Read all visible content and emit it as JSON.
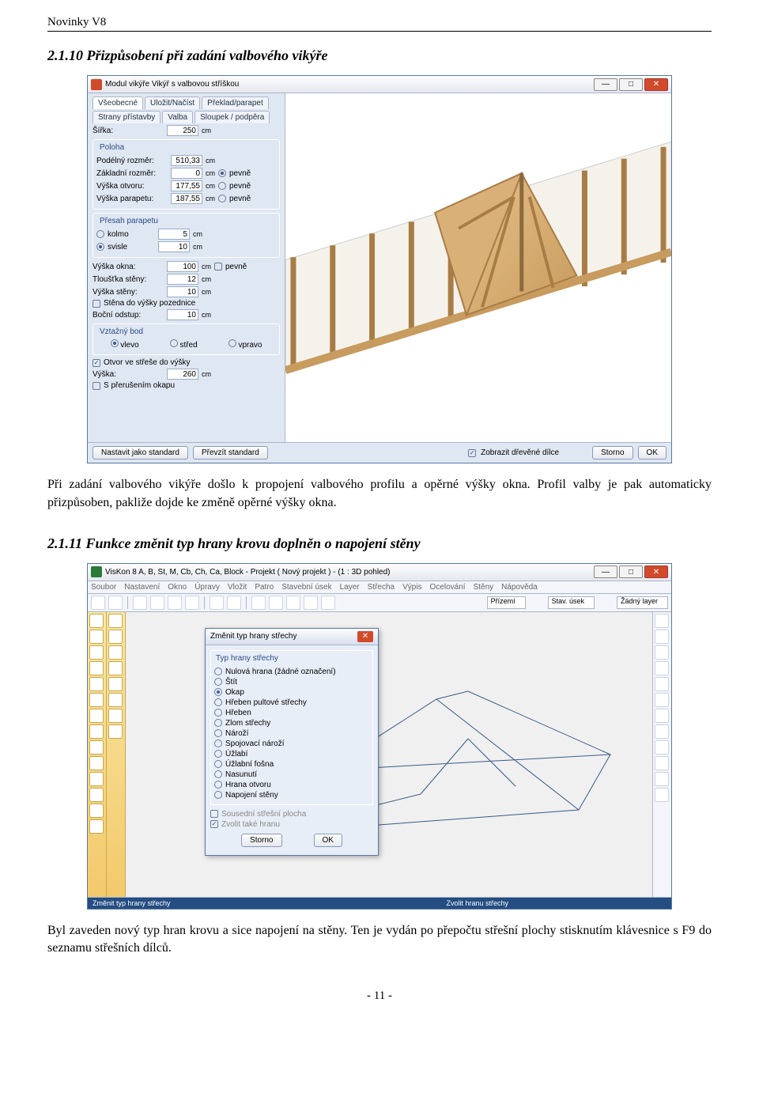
{
  "doc": {
    "header": "Novinky V8",
    "section1_num": "2.1.10",
    "section1_title": "Přizpůsobení při zadání valbového vikýře",
    "para1": "Při zadání valbového vikýře došlo k propojení valbového profilu a opěrné výšky okna. Profil valby je pak automaticky přizpůsoben, pakliže dojde ke změně opěrné výšky okna.",
    "section2_num": "2.1.11",
    "section2_title": "Funkce změnit typ hrany krovu doplněn o napojení stěny",
    "para2": "Byl zaveden nový typ hran krovu a sice napojení na stěny. Ten je vydán po přepočtu střešní plochy stisknutím klávesnice s F9 do seznamu střešních dílců.",
    "pagenum": "- 11 -"
  },
  "app1": {
    "title": "Modul vikýře Vikýř s valbovou stříškou",
    "tabs1": [
      "Všeobecné",
      "Uložit/Načíst",
      "Překlad/parapet"
    ],
    "tabs2": [
      "Strany přístavby",
      "Valba",
      "Sloupek / podpěra"
    ],
    "sirka_label": "Šířka:",
    "sirka_val": "250",
    "poloha_title": "Poloha",
    "podelny_label": "Podélný rozměr:",
    "podelny_val": "510,33",
    "zakladni_label": "Základní rozměr:",
    "zakladni_val": "0",
    "vyska_otvoru_label": "Výška otvoru:",
    "vyska_otvoru_val": "177,55",
    "vyska_parapetu_label": "Výška parapetu:",
    "vyska_parapetu_val": "187,55",
    "pevne": "pevně",
    "presah_title": "Přesah parapetu",
    "kolmo": "kolmo",
    "kolmo_val": "5",
    "svisle": "svisle",
    "svisle_val": "10",
    "vyska_okna_label": "Výška okna:",
    "vyska_okna_val": "100",
    "tloustka_label": "Tloušťka stěny:",
    "tloustka_val": "12",
    "vyska_steny_label": "Výška stěny:",
    "vyska_steny_val": "10",
    "stena_chk": "Stěna do výšky pozednice",
    "bocni_label": "Boční odstup:",
    "bocni_val": "10",
    "vztazny_title": "Vztažný bod",
    "vlevo": "vlevo",
    "stred": "střed",
    "vpravo": "vpravo",
    "otvor_chk": "Otvor ve střeše do výšky",
    "vyska2_label": "Výška:",
    "vyska2_val": "260",
    "prerus_chk": "S přerušením okapu",
    "zobrazit_chk": "Zobrazit dřevěné dílce",
    "btn_std": "Nastavit jako standard",
    "btn_prev": "Převzít standard",
    "btn_storno": "Storno",
    "btn_ok": "OK",
    "cm": "cm"
  },
  "app2": {
    "title": "VisKon 8 A, B, St, M, Cb, Ch, Ca, Block - Projekt ( Nový projekt ) - (1 : 3D pohled)",
    "menu": [
      "Soubor",
      "Nastavení",
      "Okno",
      "Úpravy",
      "Vložit",
      "Patro",
      "Stavební úsek",
      "Layer",
      "Střecha",
      "Výpis",
      "Ocelování",
      "Stěny",
      "Nápověda"
    ],
    "combo1": "Přízemí",
    "combo2_label": "Stav. úsek",
    "combo3_label": "Žádný layer",
    "dialog_title": "Změnit typ hrany střechy",
    "group_title": "Typ hrany střechy",
    "options": [
      "Nulová hrana (žádné označení)",
      "Štít",
      "Okap",
      "Hřeben pultové střechy",
      "Hřeben",
      "Zlom střechy",
      "Nároží",
      "Spojovací nároží",
      "Úžlabí",
      "Úžlabní fošna",
      "Nasunutí",
      "Hrana otvoru",
      "Napojení stěny"
    ],
    "selected_idx": 2,
    "extra_chk1": "Sousední střešní plocha",
    "extra_chk2": "Zvolit také hranu",
    "btn_storno": "Storno",
    "btn_ok": "OK",
    "status_left": "Změnit typ hrany střechy",
    "status_right": "Zvolit hranu střechy"
  }
}
